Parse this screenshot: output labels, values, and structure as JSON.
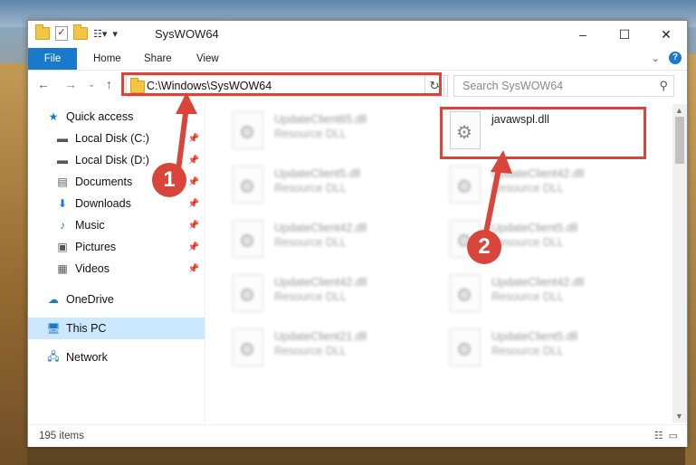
{
  "window": {
    "title": "SysWOW64",
    "controls": [
      "–",
      "☐",
      "✕"
    ]
  },
  "ribbon": {
    "tabs": [
      "File",
      "Home",
      "Share",
      "View"
    ]
  },
  "address": {
    "path": "C:\\Windows\\SysWOW64",
    "search_placeholder": "Search SysWOW64"
  },
  "sidebar": {
    "items": [
      {
        "label": "Quick access",
        "icon": "star-icon"
      },
      {
        "label": "Local Disk (C:)",
        "icon": "drive-icon"
      },
      {
        "label": "Local Disk (D:)",
        "icon": "drive-icon"
      },
      {
        "label": "Documents",
        "icon": "documents-icon"
      },
      {
        "label": "Downloads",
        "icon": "download-icon"
      },
      {
        "label": "Music",
        "icon": "music-icon"
      },
      {
        "label": "Pictures",
        "icon": "pictures-icon"
      },
      {
        "label": "Videos",
        "icon": "videos-icon"
      },
      {
        "label": "OneDrive",
        "icon": "cloud-icon"
      },
      {
        "label": "This PC",
        "icon": "pc-icon"
      },
      {
        "label": "Network",
        "icon": "network-icon"
      }
    ]
  },
  "files": [
    {
      "name": "UpdateClient65.dll",
      "type": "Resource DLL"
    },
    {
      "name": "javawspl.dll",
      "type": ""
    },
    {
      "name": "UpdateClient5.dll",
      "type": "Resource DLL"
    },
    {
      "name": "UpdateClient42.dll",
      "type": "Resource DLL"
    },
    {
      "name": "UpdateClient42.dll",
      "type": "Resource DLL"
    },
    {
      "name": "UpdateClient5.dll",
      "type": "Resource DLL"
    },
    {
      "name": "UpdateClient42.dll",
      "type": "Resource DLL"
    },
    {
      "name": "UpdateClient42.dll",
      "type": "Resource DLL"
    },
    {
      "name": "UpdateClient21.dll",
      "type": "Resource DLL"
    },
    {
      "name": "UpdateClient5.dll",
      "type": "Resource DLL"
    }
  ],
  "annotations": {
    "step1": "1",
    "step2": "2",
    "color": "#d9453a"
  },
  "status": {
    "items_count": "195 items"
  }
}
